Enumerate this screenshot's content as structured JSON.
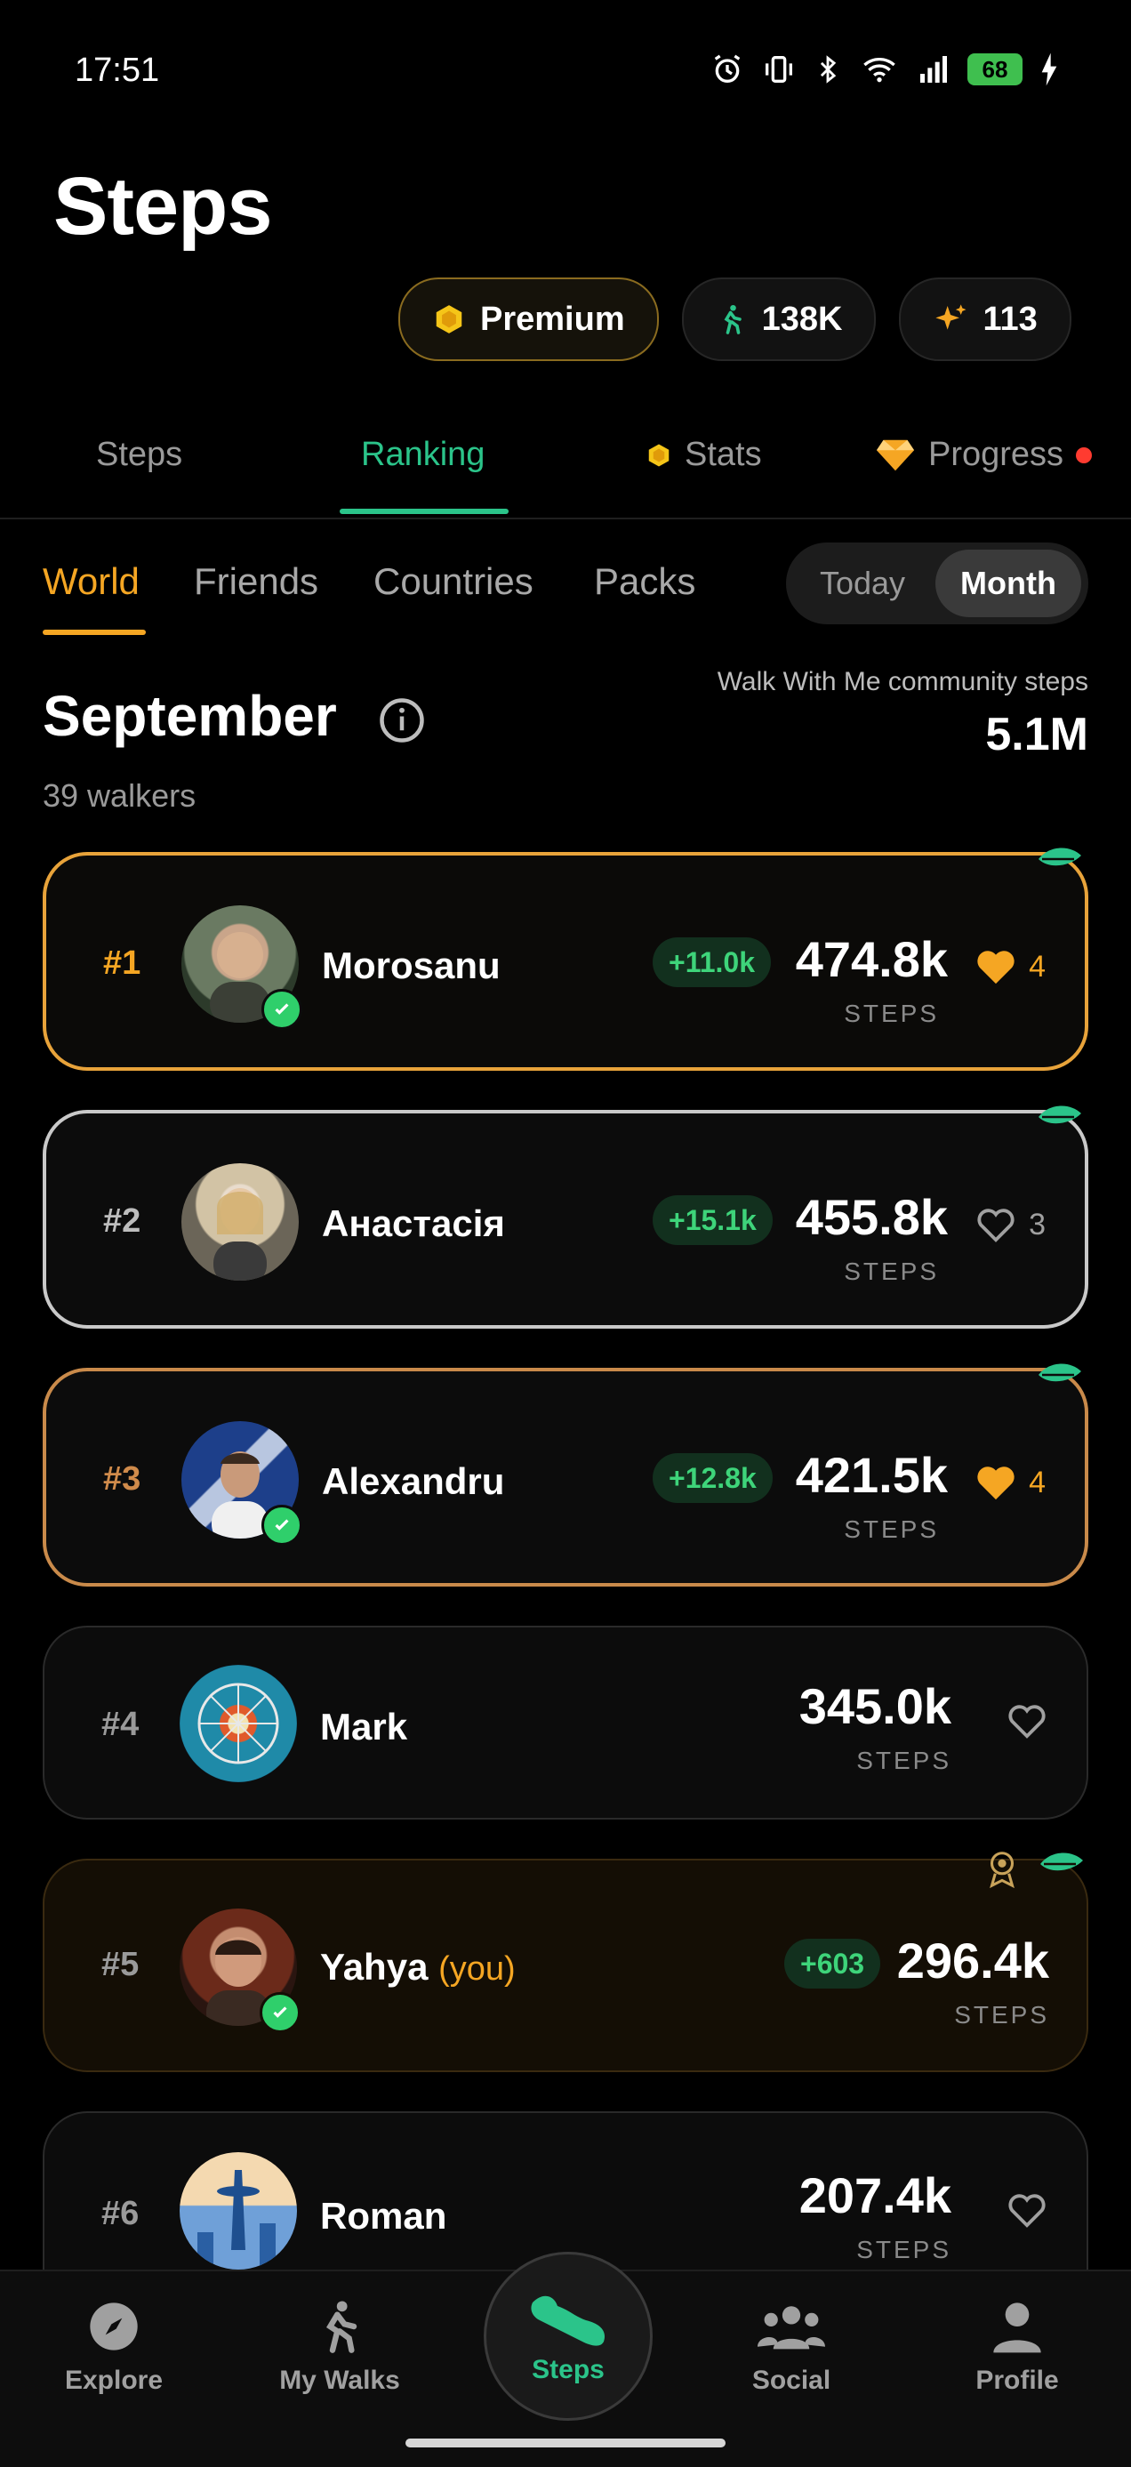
{
  "status_bar": {
    "time": "17:51",
    "battery": "68"
  },
  "header": {
    "title": "Steps",
    "chips": {
      "premium": "Premium",
      "steps_total": "138K",
      "sparkles": "113"
    }
  },
  "top_tabs": {
    "steps": "Steps",
    "ranking": "Ranking",
    "stats": "Stats",
    "progress": "Progress"
  },
  "sub_tabs": {
    "world": "World",
    "friends": "Friends",
    "countries": "Countries",
    "packs": "Packs"
  },
  "period": {
    "today": "Today",
    "month": "Month"
  },
  "board": {
    "month": "September",
    "walkers": "39 walkers",
    "community_label": "Walk With Me community steps",
    "community_value": "5.1M"
  },
  "entries": [
    {
      "rank": "#1",
      "name": "Morosanu",
      "delta": "+11.0k",
      "steps": "474.8k",
      "steps_label": "STEPS",
      "likes": "4",
      "liked": true,
      "verified": true,
      "border_color": "#e8a33a"
    },
    {
      "rank": "#2",
      "name": "Анастасія",
      "delta": "+15.1k",
      "steps": "455.8k",
      "steps_label": "STEPS",
      "likes": "3",
      "liked": false,
      "verified": false,
      "border_color": "#c9c9c9"
    },
    {
      "rank": "#3",
      "name": "Alexandru",
      "delta": "+12.8k",
      "steps": "421.5k",
      "steps_label": "STEPS",
      "likes": "4",
      "liked": true,
      "verified": true,
      "border_color": "#c98a4a"
    },
    {
      "rank": "#4",
      "name": "Mark",
      "steps": "345.0k",
      "steps_label": "STEPS",
      "verified": false
    },
    {
      "rank": "#5",
      "name": "Yahya",
      "you": "(you)",
      "delta": "+603",
      "steps": "296.4k",
      "steps_label": "STEPS",
      "verified": true
    },
    {
      "rank": "#6",
      "name": "Roman",
      "steps": "207.4k",
      "steps_label": "STEPS",
      "verified": false
    }
  ],
  "nav": {
    "explore": "Explore",
    "my_walks": "My Walks",
    "steps": "Steps",
    "social": "Social",
    "profile": "Profile"
  },
  "colors": {
    "accent_green": "#2bc48a",
    "accent_orange": "#f5a623",
    "gold": "#e8a33a",
    "silver": "#c9c9c9",
    "bronze": "#c98a4a"
  }
}
